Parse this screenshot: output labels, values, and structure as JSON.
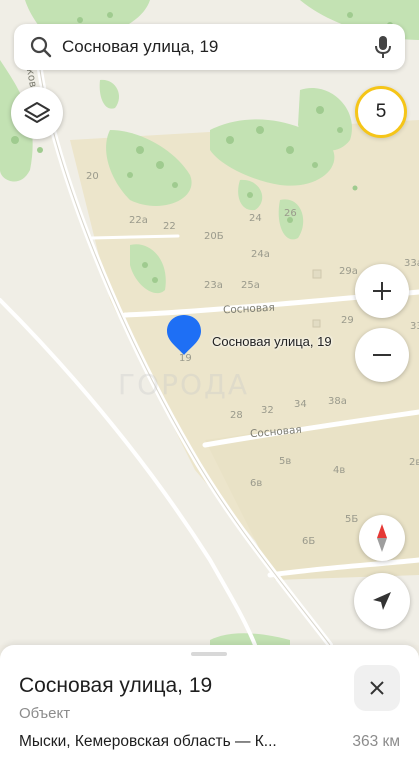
{
  "search": {
    "query": "Сосновая улица, 19"
  },
  "badge": {
    "value": "5"
  },
  "map": {
    "watermark": "ГОРОДА",
    "pin_label": "Сосновая улица, 19",
    "streets": {
      "sosnovaya_upper": "Сосновая",
      "sosnovaya_lower": "Сосновая",
      "side_fragment": "ков"
    },
    "house_numbers": {
      "n20": "20",
      "n22a": "22а",
      "n22": "22",
      "n20b": "20Б",
      "n24": "24",
      "n26": "26",
      "n24a": "24а",
      "n29a": "29а",
      "n33a": "33а",
      "n23a": "23а",
      "n25a": "25а",
      "n29": "29",
      "n33": "33",
      "n19": "19",
      "n28": "28",
      "n32": "32",
      "n34": "34",
      "n38a": "38а",
      "n5v": "5в",
      "n4v": "4в",
      "n2v": "2в",
      "n6v": "6в",
      "n5b": "5Б",
      "n6b": "6Б"
    }
  },
  "sheet": {
    "title": "Сосновая улица, 19",
    "type": "Объект",
    "address": "Мыски, Кемеровская область — К...",
    "distance": "363 км"
  },
  "colors": {
    "accent_pin": "#1e6ff5",
    "badge_ring": "#f5c518",
    "forest": "#bfe0b0",
    "residential": "#ece5cc"
  }
}
